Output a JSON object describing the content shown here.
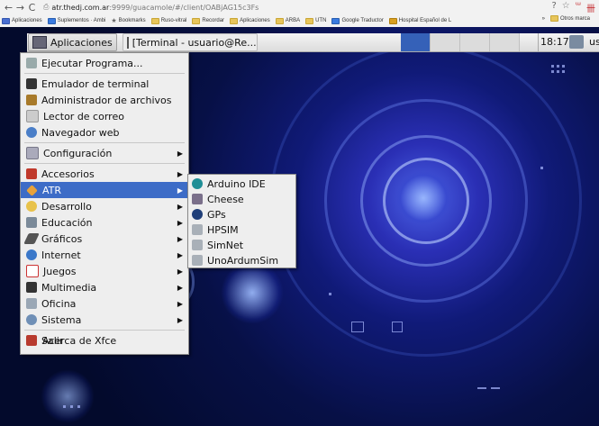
{
  "browser": {
    "nav": {
      "back": "←",
      "forward": "→",
      "reload": "C",
      "page_icon": "⎙"
    },
    "url_host": "atr.thedj.com.ar",
    "url_path": ":9999/guacamole/#/client/OABjAG15c3Fs",
    "right_icons": [
      "?",
      "☆",
      "ᵚ",
      "卌"
    ],
    "bookmarks": [
      {
        "label": "Aplicaciones",
        "icon": "apps-icon"
      },
      {
        "label": "Suplementos · Ambi",
        "icon": "favicon-icon"
      },
      {
        "label": "Bookmarks",
        "icon": "star-icon"
      },
      {
        "label": "Ruso-vitral",
        "icon": "folder-icon"
      },
      {
        "label": "Recordar",
        "icon": "folder-icon"
      },
      {
        "label": "Aplicaciones",
        "icon": "folder-icon"
      },
      {
        "label": "ARBA",
        "icon": "folder-icon"
      },
      {
        "label": "UTN",
        "icon": "folder-icon"
      },
      {
        "label": "Google Traductor",
        "icon": "favicon-icon"
      },
      {
        "label": "Hospital Español de L",
        "icon": "favicon-icon"
      }
    ],
    "bookmarks_overflow": "»",
    "other_bookmarks": "Otros marca"
  },
  "panel": {
    "applications_label": "Aplicaciones",
    "task_label": "[Terminal - usuario@Re...",
    "clock": "18:17",
    "user_label": "usuario"
  },
  "main_menu": {
    "items": [
      {
        "label": "Ejecutar Programa...",
        "icon": "run-program-icon",
        "has_sub": false
      },
      {
        "label": "Emulador de terminal",
        "icon": "terminal-icon",
        "has_sub": false
      },
      {
        "label": "Administrador de archivos",
        "icon": "file-manager-icon",
        "has_sub": false
      },
      {
        "label": "Lector de correo",
        "icon": "mail-icon",
        "has_sub": false
      },
      {
        "label": "Navegador web",
        "icon": "web-browser-icon",
        "has_sub": false
      },
      {
        "label": "Configuración",
        "icon": "settings-icon",
        "has_sub": true
      },
      {
        "label": "Accesorios",
        "icon": "accessories-icon",
        "has_sub": true
      },
      {
        "label": "ATR",
        "icon": "atr-icon",
        "has_sub": true
      },
      {
        "label": "Desarrollo",
        "icon": "development-icon",
        "has_sub": true
      },
      {
        "label": "Educación",
        "icon": "education-icon",
        "has_sub": true
      },
      {
        "label": "Gráficos",
        "icon": "graphics-icon",
        "has_sub": true
      },
      {
        "label": "Internet",
        "icon": "internet-icon",
        "has_sub": true
      },
      {
        "label": "Juegos",
        "icon": "games-icon",
        "has_sub": true
      },
      {
        "label": "Multimedia",
        "icon": "multimedia-icon",
        "has_sub": true
      },
      {
        "label": "Oficina",
        "icon": "office-icon",
        "has_sub": true
      },
      {
        "label": "Sistema",
        "icon": "system-icon",
        "has_sub": true
      },
      {
        "label": "Acerca de Xfce",
        "icon": "about-xfce-icon",
        "has_sub": false
      },
      {
        "label": "Salir",
        "icon": "logout-icon",
        "has_sub": false
      }
    ],
    "highlighted": "ATR",
    "submenu_arrow": "▶"
  },
  "submenu_atr": {
    "items": [
      {
        "label": "Arduino IDE",
        "icon": "arduino-icon"
      },
      {
        "label": "Cheese",
        "icon": "cheese-icon"
      },
      {
        "label": "GPs",
        "icon": "gps-icon"
      },
      {
        "label": "HPSIM",
        "icon": "hpsim-icon"
      },
      {
        "label": "SimNet",
        "icon": "simnet-icon"
      },
      {
        "label": "UnoArdumSim",
        "icon": "unoardumsim-icon"
      }
    ]
  },
  "colors": {
    "menu_highlight": "#3d6cc7",
    "workspace_active": "#3561b8"
  }
}
